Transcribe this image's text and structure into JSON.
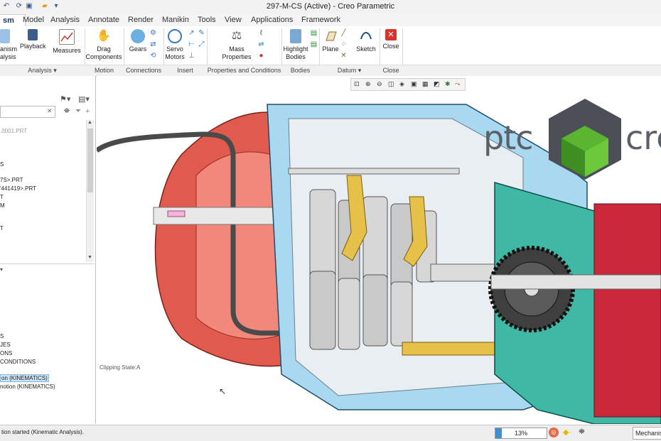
{
  "window": {
    "title": "297-M-CS (Active) - Creo Parametric"
  },
  "tabs": [
    "sm",
    "Model",
    "Analysis",
    "Annotate",
    "Render",
    "Manikin",
    "Tools",
    "View",
    "Applications",
    "Framework"
  ],
  "ribbon": {
    "mechanism_analysis": "anism\nalysis",
    "playback": "Playback",
    "measures": "Measures",
    "drag_components": "Drag\nComponents",
    "gears": "Gears",
    "servo_motors": "Servo\nMotors",
    "mass_properties": "Mass\nProperties",
    "highlight_bodies": "Highlight\nBodies",
    "plane": "Plane",
    "sketch": "Sketch",
    "close": "Close"
  },
  "groups": {
    "analysis": "Analysis ▾",
    "motion": "Motion",
    "connections": "Connections",
    "insert": "Insert",
    "properties": "Properties and Conditions",
    "bodies": "Bodies",
    "datum": "Datum ▾",
    "close": "Close"
  },
  "tree": {
    "items": [
      ".0001.PRT",
      "S",
      "7S>.PRT",
      "'441419>.PRT",
      "T",
      "M",
      "T"
    ],
    "lower_items": [
      "S",
      "JES",
      "ONS",
      "CONDITIONS"
    ],
    "selected": "on (KINEMATICS)",
    "motion": "notion (KINEMATICS)"
  },
  "viewport": {
    "clipping": "Clipping State:A",
    "logo_left": "ptc",
    "logo_right": "cre"
  },
  "status": {
    "message": "tion started (Kinematic Analysis).",
    "progress_percent": 13,
    "progress_text": "13%",
    "mode": "Mechanis"
  }
}
